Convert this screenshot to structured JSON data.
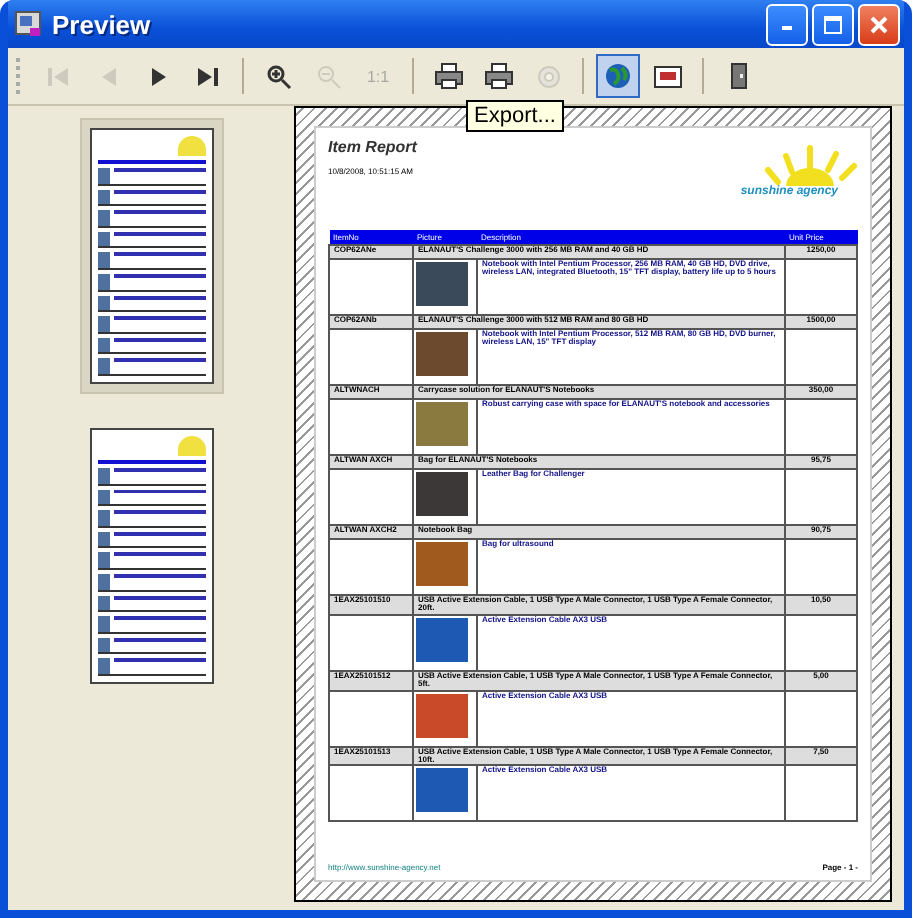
{
  "window": {
    "title": "Preview"
  },
  "toolbar": [
    {
      "kind": "first",
      "disabled": true,
      "pressed": false
    },
    {
      "kind": "prev",
      "disabled": true,
      "pressed": false
    },
    {
      "kind": "next",
      "disabled": false,
      "pressed": false
    },
    {
      "kind": "last",
      "disabled": false,
      "pressed": false
    },
    {
      "kind": "sep"
    },
    {
      "kind": "zoom-in",
      "disabled": false,
      "pressed": false
    },
    {
      "kind": "zoom-out",
      "disabled": true,
      "pressed": false
    },
    {
      "kind": "actual",
      "label": "1:1",
      "disabled": true,
      "pressed": false
    },
    {
      "kind": "sep"
    },
    {
      "kind": "print",
      "disabled": false,
      "pressed": false
    },
    {
      "kind": "print-setup",
      "disabled": false,
      "pressed": false
    },
    {
      "kind": "page-setup",
      "disabled": true,
      "pressed": false
    },
    {
      "kind": "sep"
    },
    {
      "kind": "export",
      "disabled": false,
      "pressed": true
    },
    {
      "kind": "email",
      "disabled": false,
      "pressed": false
    },
    {
      "kind": "sep"
    },
    {
      "kind": "exit",
      "disabled": false,
      "pressed": false
    }
  ],
  "tooltip": "Export...",
  "thumbnails": [
    {
      "selected": true
    },
    {
      "selected": false
    }
  ],
  "report": {
    "title": "Item Report",
    "date": "10/8/2008, 10:51:15 AM",
    "logo": "sunshine agency",
    "columns": [
      "ItemNo",
      "Picture",
      "Description",
      "Unit Price"
    ],
    "items": [
      {
        "item_no": "COP62ANe",
        "name": "ELANAUT'S Challenge 3000 with 256 MB RAM and 40 GB HD",
        "description": "Notebook with Intel Pentium Processor, 256 MB RAM, 40 GB HD, DVD drive, wireless LAN, integrated Bluetooth, 15\" TFT display, battery life up to 5 hours",
        "price": "1250,00",
        "color": "#3a4a5a"
      },
      {
        "item_no": "COP62ANb",
        "name": "ELANAUT'S Challenge 3000 with 512 MB RAM and 80 GB HD",
        "description": "Notebook with Intel Pentium Processor, 512 MB RAM, 80 GB HD, DVD burner, wireless LAN, 15\" TFT display",
        "price": "1500,00",
        "color": "#6b4a2e"
      },
      {
        "item_no": "ALTWNACH",
        "name": "Carrycase solution for ELANAUT'S Notebooks",
        "description": "Robust carrying case with space for ELANAUT'S notebook and accessories",
        "price": "350,00",
        "color": "#8a7a40"
      },
      {
        "item_no": "ALTWAN AXCH",
        "name": "Bag for ELANAUT'S Notebooks",
        "description": "Leather Bag for Challenger",
        "price": "95,75",
        "color": "#3c3838"
      },
      {
        "item_no": "ALTWAN AXCH2",
        "name": "Notebook Bag",
        "description": "Bag for ultrasound",
        "price": "90,75",
        "color": "#a05a1e"
      },
      {
        "item_no": "1EAX25101510",
        "name": "USB Active Extension Cable, 1 USB Type A Male Connector, 1 USB Type A Female Connector, 20ft.",
        "description": "Active Extension Cable AX3 USB",
        "price": "10,50",
        "color": "#1e5ab4"
      },
      {
        "item_no": "1EAX25101512",
        "name": "USB Active Extension Cable, 1 USB Type A Male Connector, 1 USB Type A Female Connector, 5ft.",
        "description": "Active Extension Cable AX3 USB",
        "price": "5,00",
        "color": "#c84a28"
      },
      {
        "item_no": "1EAX25101513",
        "name": "USB Active Extension Cable, 1 USB Type A Male Connector, 1 USB Type A Female Connector, 10ft.",
        "description": "Active Extension Cable AX3 USB",
        "price": "7,50",
        "color": "#1e5ab4"
      }
    ],
    "footer_link": "http://www.sunshine-agency.net",
    "page_label": "Page - 1 -"
  }
}
